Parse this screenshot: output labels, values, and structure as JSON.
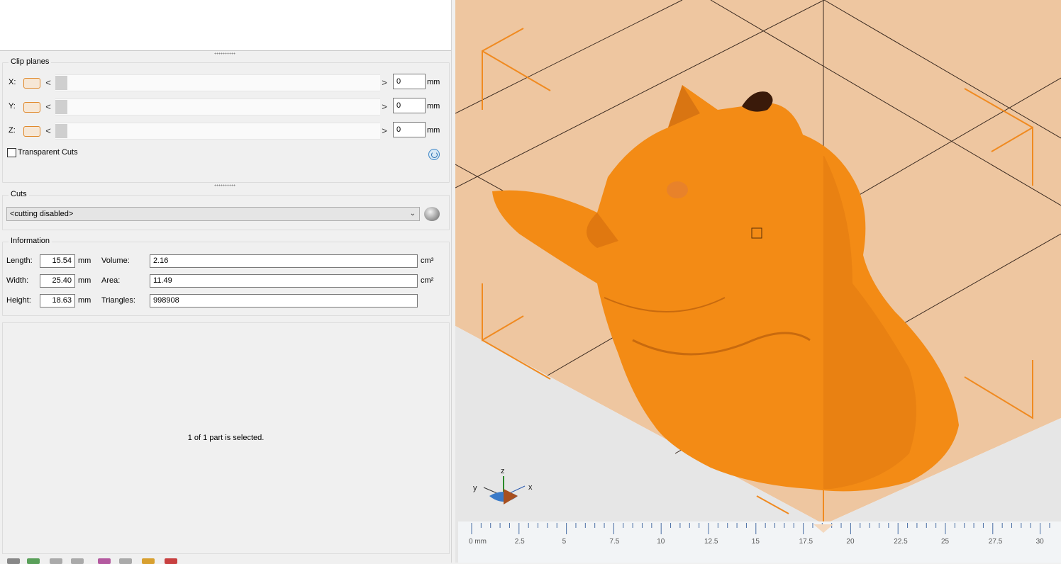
{
  "clip_planes": {
    "title": "Clip planes",
    "rows": [
      {
        "axis": "X:",
        "value": "0",
        "unit": "mm"
      },
      {
        "axis": "Y:",
        "value": "0",
        "unit": "mm"
      },
      {
        "axis": "Z:",
        "value": "0",
        "unit": "mm"
      }
    ],
    "transparent_cuts_label": "Transparent Cuts",
    "arrow_left": "<",
    "arrow_right": ">"
  },
  "cuts": {
    "title": "Cuts",
    "selected": "<cutting disabled>"
  },
  "information": {
    "title": "Information",
    "length_label": "Length:",
    "length_value": "15.54",
    "length_unit": "mm",
    "width_label": "Width:",
    "width_value": "25.40",
    "width_unit": "mm",
    "height_label": "Height:",
    "height_value": "18.63",
    "height_unit": "mm",
    "volume_label": "Volume:",
    "volume_value": "2.16",
    "volume_unit": "cm³",
    "area_label": "Area:",
    "area_value": "11.49",
    "area_unit": "cm²",
    "triangles_label": "Triangles:",
    "triangles_value": "998908"
  },
  "selection_status": "1 of 1 part is selected.",
  "viewport": {
    "axis_x": "x",
    "axis_y": "y",
    "axis_z": "z",
    "ruler_labels": [
      "0 mm",
      "2.5",
      "5",
      "7.5",
      "10",
      "12.5",
      "15",
      "17.5",
      "20",
      "22.5",
      "25",
      "27.5",
      "30"
    ],
    "model_color": "#f38b15",
    "bed_color": "#eec6a0"
  }
}
